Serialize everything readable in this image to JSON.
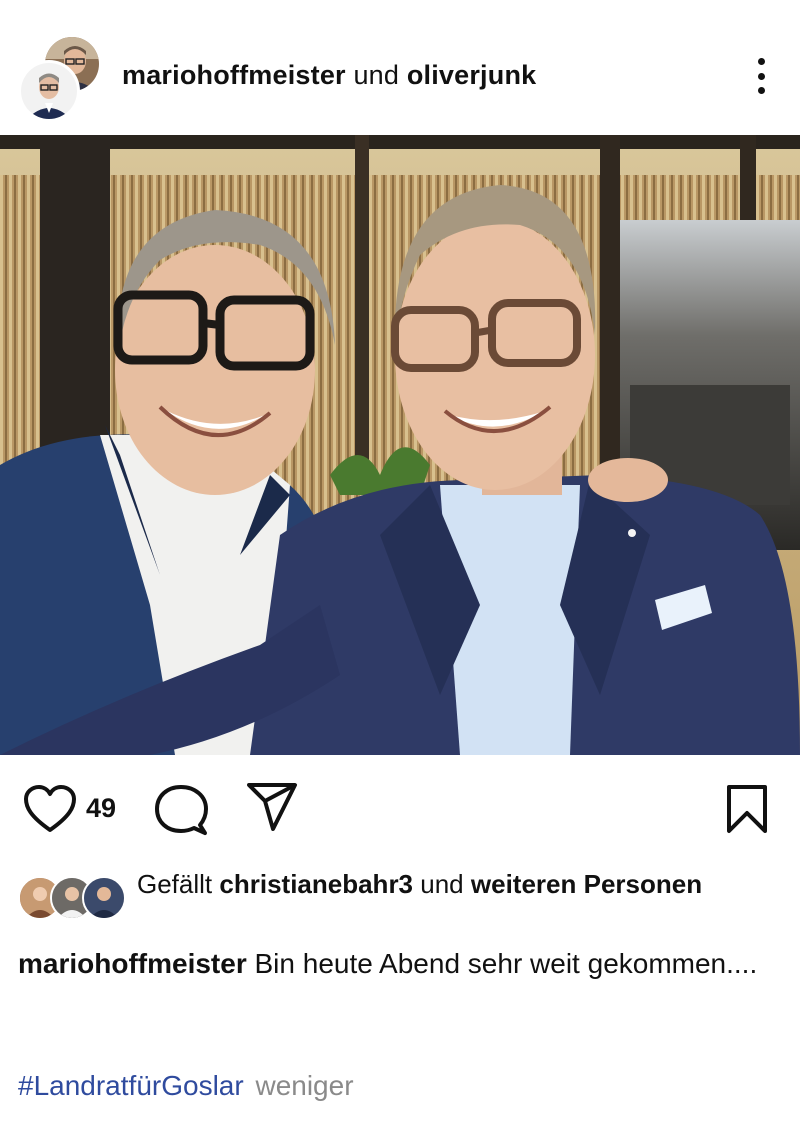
{
  "header": {
    "user1": "mariohoffmeister",
    "joiner": "und",
    "user2": "oliverjunk"
  },
  "actions": {
    "like_count": "49"
  },
  "likes": {
    "prefix": "Gefällt",
    "user": "christianebahr3",
    "middle": "und",
    "others": "weiteren Personen"
  },
  "caption": {
    "user": "mariohoffmeister",
    "text": "Bin heute Abend sehr weit gekommen...."
  },
  "tags": {
    "hashtag": "#LandratfürGoslar",
    "less": "weniger"
  },
  "icons": [
    "heart-icon",
    "comment-icon",
    "share-icon",
    "bookmark-icon",
    "more-icon"
  ],
  "colors": {
    "hashtag": "#2f4b9e",
    "muted": "#8a8a8a"
  }
}
